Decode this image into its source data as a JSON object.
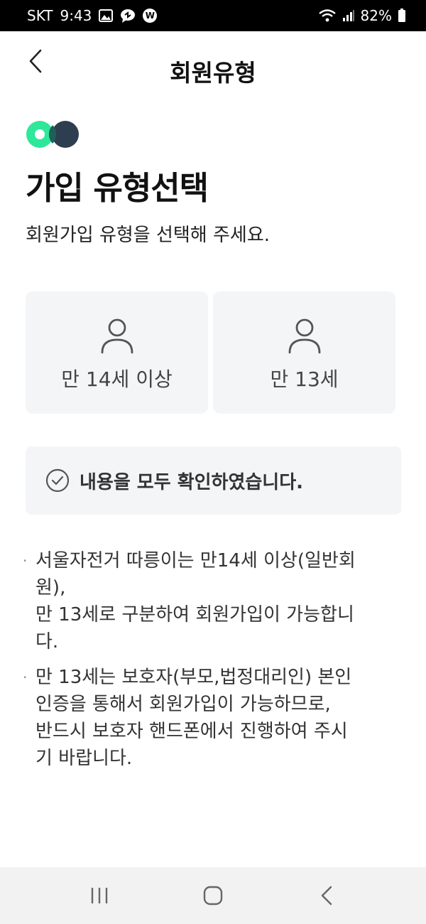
{
  "status_bar": {
    "carrier": "SKT",
    "time": "9:43",
    "battery": "82%",
    "icons": [
      "gallery-icon",
      "chat-icon",
      "w-badge-icon",
      "wifi-icon",
      "signal-icon",
      "battery-icon"
    ],
    "w_badge": "W"
  },
  "header": {
    "title": "회원유형",
    "back_icon": "chevron-left-icon"
  },
  "main": {
    "heading": "가입 유형선택",
    "subtitle": "회원가입 유형을 선택해 주세요.",
    "cards": [
      {
        "label": "만 14세 이상",
        "icon": "person-icon"
      },
      {
        "label": "만 13세",
        "icon": "person-icon"
      }
    ],
    "confirm": {
      "label": "내용을 모두 확인하였습니다.",
      "icon": "check-circle-icon",
      "checked": false
    },
    "notes": [
      [
        "서울자전거 따릉이는 만14세 이상(일반회",
        "원),",
        "만 13세로 구분하여 회원가입이 가능합니",
        "다."
      ],
      [
        "만 13세는 보호자(부모,법정대리인) 본인",
        "인증을 통해서 회원가입이 가능하므로,",
        "반드시 보호자 핸드폰에서 진행하여 주시",
        "기 바랍니다."
      ]
    ],
    "note_bullet": "·"
  },
  "colors": {
    "logo_green": "#2ee89a",
    "logo_navy": "#2d3e50",
    "card_bg": "#f4f5f7",
    "text_dark": "#111111"
  },
  "nav_bar": {
    "buttons": [
      "recent-apps-icon",
      "home-icon",
      "back-icon"
    ]
  }
}
